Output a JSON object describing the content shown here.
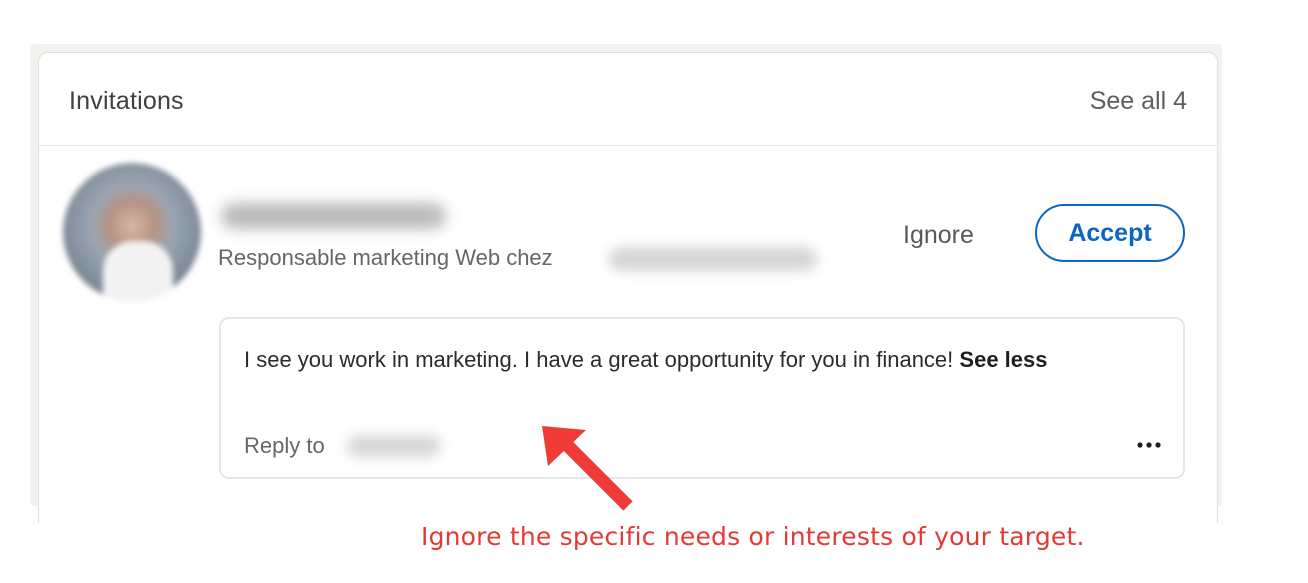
{
  "card": {
    "title": "Invitations",
    "see_all_label": "See all 4"
  },
  "invitation": {
    "headline": "Responsable marketing Web chez",
    "ignore_label": "Ignore",
    "accept_label": "Accept",
    "message": {
      "text": "I see you work in marketing. I have a great opportunity for you in finance!",
      "see_less_label": "See less",
      "reply_label": "Reply to"
    }
  },
  "icons": {
    "more": "more-horizontal-icon",
    "annotation_arrow": "arrow-icon"
  },
  "annotation": {
    "caption": "Ignore the specific needs or interests of your target.",
    "color": "#e53935"
  },
  "colors": {
    "accent": "#0a66c2"
  }
}
